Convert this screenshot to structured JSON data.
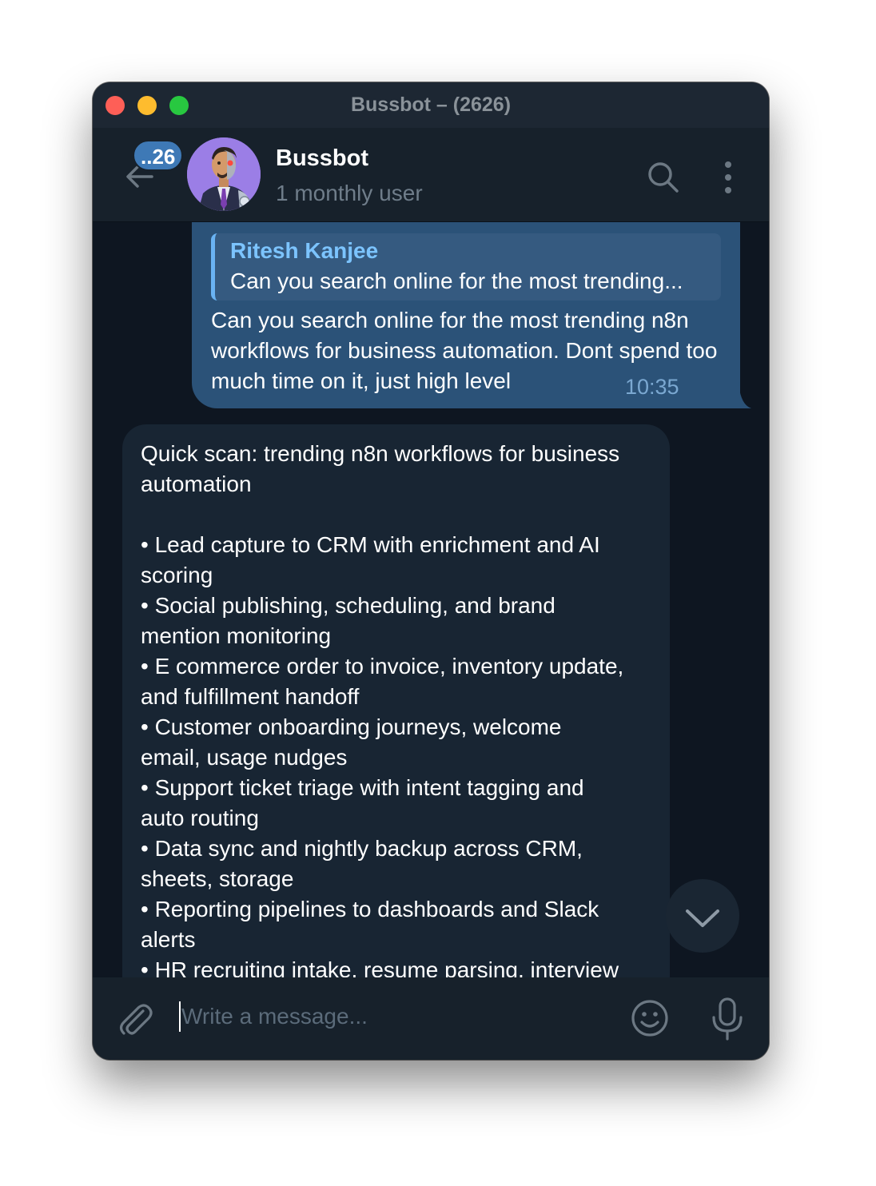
{
  "window": {
    "title": "Bussbot – (2626)"
  },
  "header": {
    "unread_badge": "..26",
    "chat_name": "Bussbot",
    "chat_status": "1 monthly user",
    "icons": {
      "back": "arrow-left-icon",
      "search": "search-icon",
      "more": "more-vertical-icon"
    }
  },
  "messages": {
    "outgoing": {
      "reply_to": {
        "name": "Ritesh Kanjee",
        "preview": "Can you search online for the most trending..."
      },
      "text": "Can you search online for the most trending n8n workflows for business automation. Dont spend too much time on it, just high level",
      "time": "10:35",
      "status": "read"
    },
    "incoming": {
      "lines": [
        "Quick scan: trending n8n workflows for business",
        "automation",
        "",
        "• Lead capture to CRM with enrichment and AI",
        "scoring",
        "• Social publishing, scheduling, and brand",
        "mention monitoring",
        "• E commerce order to invoice, inventory update,",
        "and fulfillment handoff",
        "• Customer onboarding journeys, welcome",
        "email, usage nudges",
        "• Support ticket triage with intent tagging and",
        "auto routing",
        "• Data sync and nightly backup across CRM,",
        "sheets, storage",
        "• Reporting pipelines to dashboards and Slack",
        "alerts",
        "• HR recruiting intake, resume parsing, interview"
      ]
    }
  },
  "composer": {
    "placeholder": "Write a message...",
    "value": ""
  },
  "colors": {
    "window_bg": "#0e1621",
    "header_bg": "#17212b",
    "outgoing_bubble": "#2b5278",
    "incoming_bubble": "#182533",
    "accent": "#6ab3f3",
    "badge": "#3e79b6"
  }
}
